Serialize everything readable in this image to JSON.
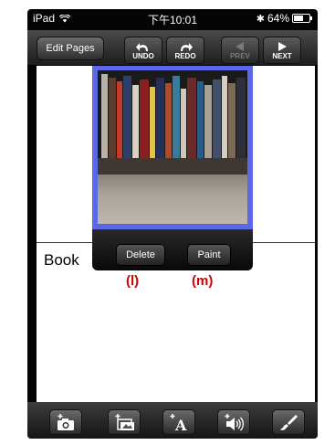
{
  "status_bar": {
    "device": "iPad",
    "time": "下午10:01",
    "battery": "64%",
    "battery_level": 0.64
  },
  "navbar": {
    "edit_pages": "Edit Pages",
    "undo": "UNDO",
    "redo": "REDO",
    "prev": "PREV",
    "next": "NEXT"
  },
  "page": {
    "item_label": "Book"
  },
  "popup": {
    "delete": "Delete",
    "paint": "Paint"
  },
  "captions": {
    "l": "(l)",
    "m": "(m)"
  },
  "colors": {
    "frame": "#5c67e6",
    "caption": "#d40000"
  },
  "toolbar_icons": [
    "add-photo-camera-icon",
    "add-image-icon",
    "add-text-icon",
    "add-sound-icon",
    "paint-brush-icon"
  ]
}
